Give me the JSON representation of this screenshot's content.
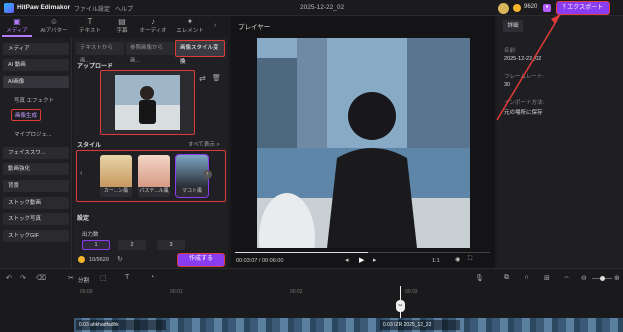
{
  "app": {
    "title": "HitPaw Edimakor",
    "menu": [
      "ファイル",
      "設定",
      "ヘルプ"
    ],
    "date": "2025-12-22_02",
    "credits": "9620",
    "export": "エクスポート"
  },
  "toolbar": [
    {
      "icon": "media-icon",
      "glyph": "▣",
      "label": "メディア",
      "active": true
    },
    {
      "icon": "avatar-icon",
      "glyph": "☺",
      "label": "AIアバター"
    },
    {
      "icon": "text-icon",
      "glyph": "T",
      "label": "テキスト"
    },
    {
      "icon": "subtitle-icon",
      "glyph": "▤",
      "label": "字幕"
    },
    {
      "icon": "audio-icon",
      "glyph": "♪",
      "label": "オーディオ"
    },
    {
      "icon": "element-icon",
      "glyph": "✦",
      "label": "エレメント"
    }
  ],
  "sidebar": {
    "items": [
      "メディア",
      "AI 動画",
      "AI画像",
      "フェイススワ...",
      "動画強化",
      "背景",
      "ストック動画",
      "ストック写真",
      "ストックGIF"
    ],
    "sub": [
      "写真 エフェクト",
      "画像生成",
      "マイプロジェ..."
    ]
  },
  "panel": {
    "tabs": [
      "テキストから画...",
      "参照画像から画...",
      "画像スタイル変換"
    ],
    "upload": "アップロード",
    "style": "スタイル",
    "see_all": "すべて表示 >",
    "styles": [
      "カー...ン風",
      "パステ...ル風",
      "マコト風"
    ],
    "settings": "設定",
    "output_count": "出力数",
    "counts": [
      "1",
      "2",
      "3"
    ],
    "credits": "10/9620",
    "generate": "作成する"
  },
  "player": {
    "title": "プレイヤー",
    "time": "00:03:07 / 00:06:00",
    "ratio": "1:1"
  },
  "details": {
    "tab": "詳細",
    "name_label": "名前:",
    "name": "2025-12-22_02",
    "fps_label": "フレームレート:",
    "fps": "30",
    "export_label": "インポート方法:",
    "export": "元の場所に保存"
  },
  "timeline": {
    "split": "分割",
    "times": [
      "00:00",
      "00:01",
      "00:02",
      "00:03"
    ],
    "clip1": "0.03 ahkhadfadhk",
    "clip2": "0.03 IZR 2025_12_22"
  }
}
